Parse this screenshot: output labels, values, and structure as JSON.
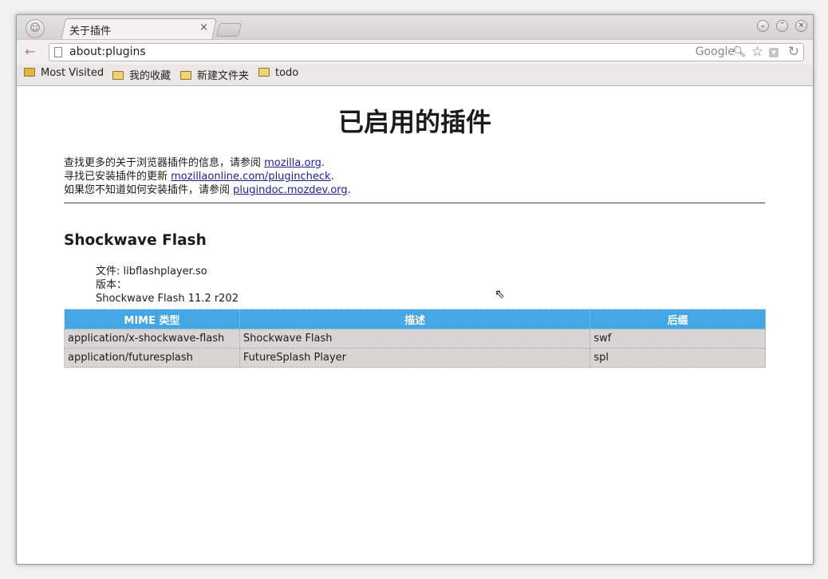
{
  "tab": {
    "title": "关于插件",
    "close": "×"
  },
  "window_controls": {
    "minimize": "⌄",
    "maximize": "⌃",
    "close": "×"
  },
  "navbar": {
    "back": "←",
    "url": "about:plugins",
    "search_engine": "Google",
    "icons": [
      "page-icon",
      "search-icon",
      "star-icon",
      "dropdown-icon",
      "reload-icon"
    ]
  },
  "bookmarks": [
    {
      "label": "Most Visited",
      "icon": "most-visited-folder-icon"
    },
    {
      "label": "我的收藏",
      "icon": "folder-icon"
    },
    {
      "label": "新建文件夹",
      "icon": "folder-icon"
    },
    {
      "label": "todo",
      "icon": "folder-icon"
    }
  ],
  "page": {
    "title": "已启用的插件",
    "info": [
      {
        "text": "查找更多的关于浏览器插件的信息，请参阅 ",
        "link": "mozilla.org",
        "suffix": "."
      },
      {
        "text": "寻找已安装插件的更新 ",
        "link": "mozillaonline.com/plugincheck",
        "suffix": "."
      },
      {
        "text": "如果您不知道如何安装插件，请参阅 ",
        "link": "plugindoc.mozdev.org",
        "suffix": "."
      }
    ],
    "plugin": {
      "name": "Shockwave Flash",
      "file": "文件: libflashplayer.so",
      "version_label": "版本：",
      "description": "Shockwave Flash 11.2 r202"
    },
    "table": {
      "headers": [
        "MIME 类型",
        "描述",
        "后缀"
      ],
      "rows": [
        [
          "application/x-shockwave-flash",
          "Shockwave Flash",
          "swf"
        ],
        [
          "application/futuresplash",
          "FutureSplash Player",
          "spl"
        ]
      ]
    }
  },
  "colors": {
    "table_header": "#44a6e3",
    "table_row": "#d9d5d2",
    "link": "#1d1d9e"
  }
}
